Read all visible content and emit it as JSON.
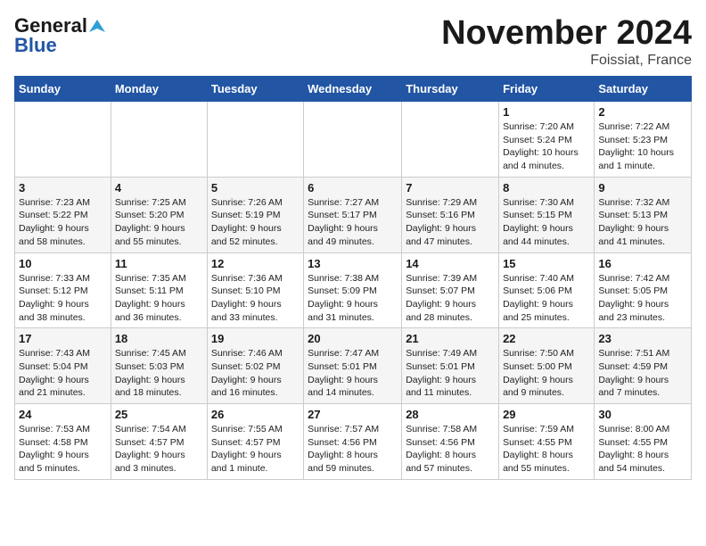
{
  "header": {
    "logo_general": "General",
    "logo_blue": "Blue",
    "month_title": "November 2024",
    "location": "Foissiat, France"
  },
  "weekdays": [
    "Sunday",
    "Monday",
    "Tuesday",
    "Wednesday",
    "Thursday",
    "Friday",
    "Saturday"
  ],
  "weeks": [
    [
      {
        "day": "",
        "info": ""
      },
      {
        "day": "",
        "info": ""
      },
      {
        "day": "",
        "info": ""
      },
      {
        "day": "",
        "info": ""
      },
      {
        "day": "",
        "info": ""
      },
      {
        "day": "1",
        "info": "Sunrise: 7:20 AM\nSunset: 5:24 PM\nDaylight: 10 hours\nand 4 minutes."
      },
      {
        "day": "2",
        "info": "Sunrise: 7:22 AM\nSunset: 5:23 PM\nDaylight: 10 hours\nand 1 minute."
      }
    ],
    [
      {
        "day": "3",
        "info": "Sunrise: 7:23 AM\nSunset: 5:22 PM\nDaylight: 9 hours\nand 58 minutes."
      },
      {
        "day": "4",
        "info": "Sunrise: 7:25 AM\nSunset: 5:20 PM\nDaylight: 9 hours\nand 55 minutes."
      },
      {
        "day": "5",
        "info": "Sunrise: 7:26 AM\nSunset: 5:19 PM\nDaylight: 9 hours\nand 52 minutes."
      },
      {
        "day": "6",
        "info": "Sunrise: 7:27 AM\nSunset: 5:17 PM\nDaylight: 9 hours\nand 49 minutes."
      },
      {
        "day": "7",
        "info": "Sunrise: 7:29 AM\nSunset: 5:16 PM\nDaylight: 9 hours\nand 47 minutes."
      },
      {
        "day": "8",
        "info": "Sunrise: 7:30 AM\nSunset: 5:15 PM\nDaylight: 9 hours\nand 44 minutes."
      },
      {
        "day": "9",
        "info": "Sunrise: 7:32 AM\nSunset: 5:13 PM\nDaylight: 9 hours\nand 41 minutes."
      }
    ],
    [
      {
        "day": "10",
        "info": "Sunrise: 7:33 AM\nSunset: 5:12 PM\nDaylight: 9 hours\nand 38 minutes."
      },
      {
        "day": "11",
        "info": "Sunrise: 7:35 AM\nSunset: 5:11 PM\nDaylight: 9 hours\nand 36 minutes."
      },
      {
        "day": "12",
        "info": "Sunrise: 7:36 AM\nSunset: 5:10 PM\nDaylight: 9 hours\nand 33 minutes."
      },
      {
        "day": "13",
        "info": "Sunrise: 7:38 AM\nSunset: 5:09 PM\nDaylight: 9 hours\nand 31 minutes."
      },
      {
        "day": "14",
        "info": "Sunrise: 7:39 AM\nSunset: 5:07 PM\nDaylight: 9 hours\nand 28 minutes."
      },
      {
        "day": "15",
        "info": "Sunrise: 7:40 AM\nSunset: 5:06 PM\nDaylight: 9 hours\nand 25 minutes."
      },
      {
        "day": "16",
        "info": "Sunrise: 7:42 AM\nSunset: 5:05 PM\nDaylight: 9 hours\nand 23 minutes."
      }
    ],
    [
      {
        "day": "17",
        "info": "Sunrise: 7:43 AM\nSunset: 5:04 PM\nDaylight: 9 hours\nand 21 minutes."
      },
      {
        "day": "18",
        "info": "Sunrise: 7:45 AM\nSunset: 5:03 PM\nDaylight: 9 hours\nand 18 minutes."
      },
      {
        "day": "19",
        "info": "Sunrise: 7:46 AM\nSunset: 5:02 PM\nDaylight: 9 hours\nand 16 minutes."
      },
      {
        "day": "20",
        "info": "Sunrise: 7:47 AM\nSunset: 5:01 PM\nDaylight: 9 hours\nand 14 minutes."
      },
      {
        "day": "21",
        "info": "Sunrise: 7:49 AM\nSunset: 5:01 PM\nDaylight: 9 hours\nand 11 minutes."
      },
      {
        "day": "22",
        "info": "Sunrise: 7:50 AM\nSunset: 5:00 PM\nDaylight: 9 hours\nand 9 minutes."
      },
      {
        "day": "23",
        "info": "Sunrise: 7:51 AM\nSunset: 4:59 PM\nDaylight: 9 hours\nand 7 minutes."
      }
    ],
    [
      {
        "day": "24",
        "info": "Sunrise: 7:53 AM\nSunset: 4:58 PM\nDaylight: 9 hours\nand 5 minutes."
      },
      {
        "day": "25",
        "info": "Sunrise: 7:54 AM\nSunset: 4:57 PM\nDaylight: 9 hours\nand 3 minutes."
      },
      {
        "day": "26",
        "info": "Sunrise: 7:55 AM\nSunset: 4:57 PM\nDaylight: 9 hours\nand 1 minute."
      },
      {
        "day": "27",
        "info": "Sunrise: 7:57 AM\nSunset: 4:56 PM\nDaylight: 8 hours\nand 59 minutes."
      },
      {
        "day": "28",
        "info": "Sunrise: 7:58 AM\nSunset: 4:56 PM\nDaylight: 8 hours\nand 57 minutes."
      },
      {
        "day": "29",
        "info": "Sunrise: 7:59 AM\nSunset: 4:55 PM\nDaylight: 8 hours\nand 55 minutes."
      },
      {
        "day": "30",
        "info": "Sunrise: 8:00 AM\nSunset: 4:55 PM\nDaylight: 8 hours\nand 54 minutes."
      }
    ]
  ]
}
